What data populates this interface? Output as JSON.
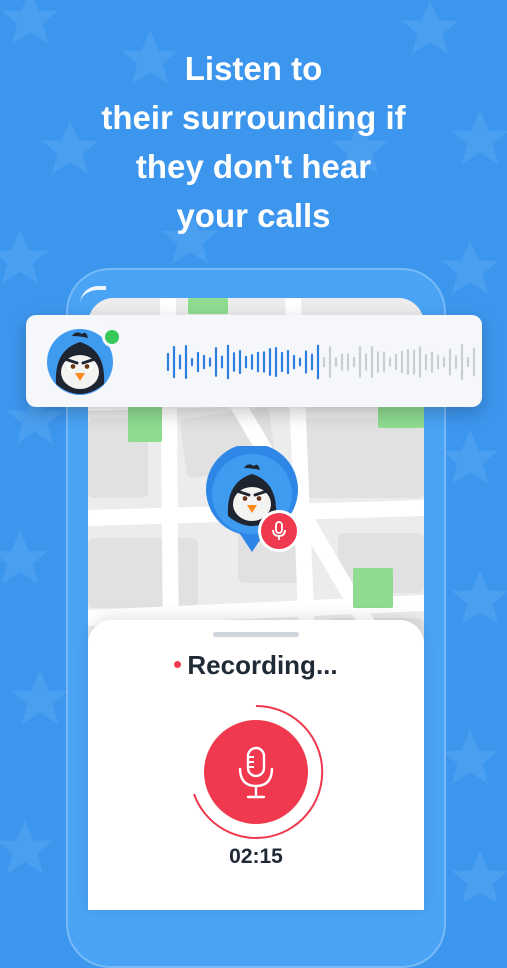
{
  "headline": {
    "lines": [
      "Listen to",
      "their surrounding if",
      "they don't hear",
      "your calls"
    ]
  },
  "audio_card": {
    "avatar_icon": "penguin-avatar-icon",
    "status": "online"
  },
  "map_pin": {
    "avatar_icon": "penguin-avatar-icon",
    "badge_icon": "microphone-icon"
  },
  "recording": {
    "status_text": "Recording...",
    "timer": "02:15",
    "button_icon": "microphone-icon"
  },
  "colors": {
    "background": "#3d96ee",
    "accent_red": "#f0394e",
    "online_green": "#38c95a",
    "wave_blue": "#2f7fe0",
    "wave_gray": "#c9ced6"
  }
}
